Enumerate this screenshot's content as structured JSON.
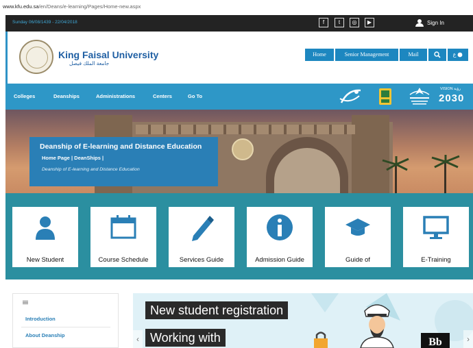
{
  "browser": {
    "url_host": "www.kfu.edu.sa",
    "url_path": "/en/Deans/e-learning/Pages/Home-new.aspx"
  },
  "topbar": {
    "date": "Sunday 06/08/1439 - 22/04/2018",
    "social": [
      {
        "icon": "facebook-icon",
        "glyph": "f"
      },
      {
        "icon": "twitter-icon",
        "glyph": "t"
      },
      {
        "icon": "instagram-icon",
        "glyph": "◎"
      },
      {
        "icon": "youtube-icon",
        "glyph": "▶"
      }
    ],
    "signin": "Sign In"
  },
  "header": {
    "university_name": "King Faisal University",
    "university_name_ar": "جامعة الملك فيصل",
    "nav": [
      "Home",
      "Senior Management",
      "Mail"
    ],
    "search_icon": "search-icon",
    "lang_label": "ع"
  },
  "mainnav": {
    "items": [
      "Colleges",
      "Deanships",
      "Administrations",
      "Centers",
      "Go To"
    ],
    "logos": {
      "vision_top": "VISION رؤية",
      "vision_year": "2030"
    }
  },
  "hero": {
    "title": "Deanship of E-learning and Distance Education",
    "crumb_home": "Home Page",
    "crumb_sep": "|",
    "crumb_deanships": "DeanShips",
    "crumb_sep2": "|",
    "subtitle": "Deanship of E-learning and Distance Education"
  },
  "tiles": [
    {
      "label": "New Student",
      "icon": "student-icon"
    },
    {
      "label": "Course Schedule",
      "icon": "calendar-icon"
    },
    {
      "label": "Services Guide",
      "icon": "pencil-icon"
    },
    {
      "label": "Admission Guide",
      "icon": "info-icon"
    },
    {
      "label": "Guide of",
      "icon": "graduation-cap-icon"
    },
    {
      "label": "E-Training",
      "icon": "monitor-icon"
    }
  ],
  "sidebar": {
    "links": [
      "Introduction",
      "About Deanship"
    ]
  },
  "banner": {
    "line1": "New student registration",
    "line2": "Working with",
    "badge": "Bb"
  },
  "colors": {
    "topbar": "#232323",
    "primary": "#2e97c7",
    "tiles_bg": "#2b8fa0",
    "dark_blue": "#1f5fa3"
  }
}
